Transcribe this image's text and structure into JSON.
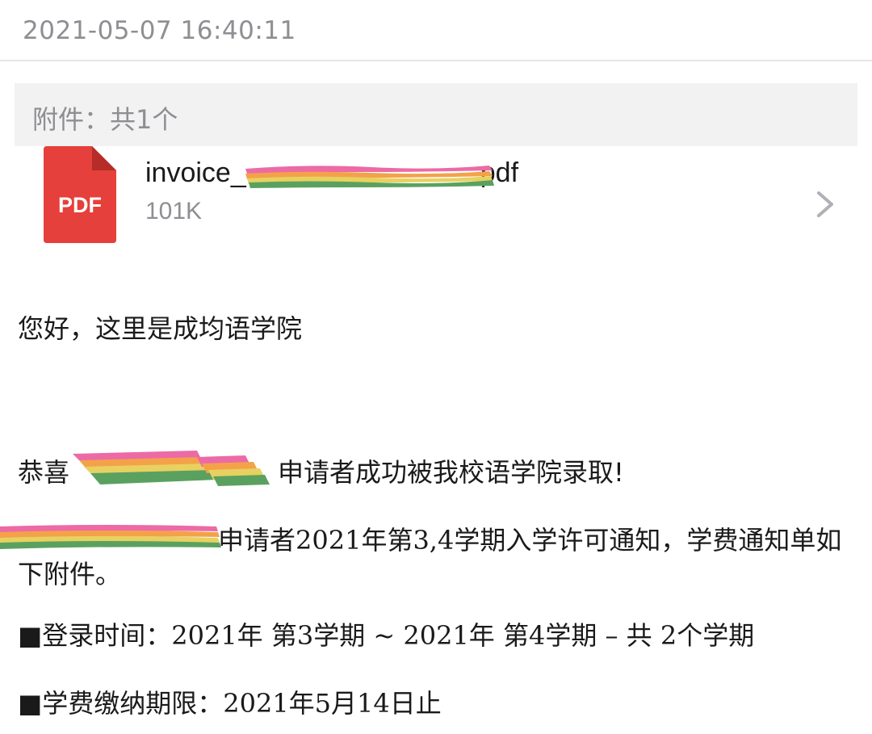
{
  "header": {
    "timestamp": "2021-05-07 16:40:11"
  },
  "attachments": {
    "summary": "附件：共1个",
    "file": {
      "name_prefix": "invoice_",
      "name_suffix": "pdf",
      "size": "101K",
      "type_label": "PDF",
      "icon": "pdf-file-icon"
    },
    "open_icon": "chevron-right-icon"
  },
  "message": {
    "greeting": "您好，这里是成均语学院",
    "congrats_prefix": "恭喜",
    "congrats_suffix": "申请者成功被我校语学院录取!",
    "notice_line1": "申请者2021年第3,4学期入学许可通知，学费通知单如",
    "notice_line2": "下附件。",
    "term_line": "■登录时间：2021年 第3学期 ~ 2021年 第4学期 – 共 2个学期",
    "deadline_line": "■学费缴纳期限：2021年5月14日止"
  },
  "colors": {
    "pdf_red": "#e5403b",
    "pdf_fold": "#b52c28",
    "muted": "#8e8e93",
    "redact_pink": "#ec6aa5",
    "redact_orange": "#f3a24a",
    "redact_yellow": "#e8d160",
    "redact_green": "#5aa160"
  }
}
